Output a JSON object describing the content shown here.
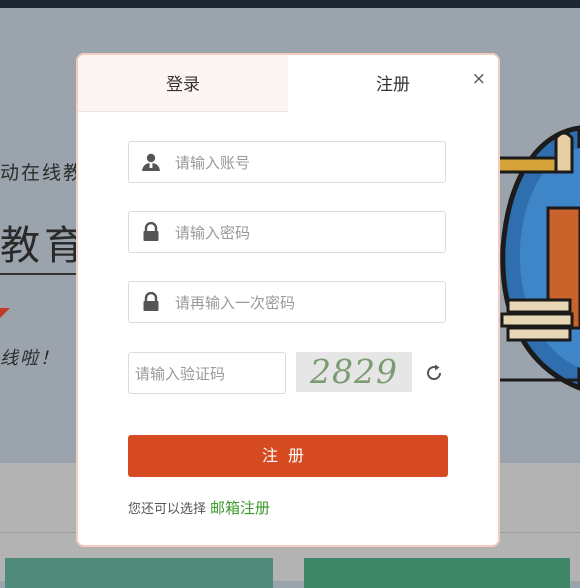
{
  "background": {
    "line1": "动在线教",
    "line2": "教育系",
    "line3": "线啦！"
  },
  "modal": {
    "tabs": [
      {
        "label": "登录",
        "active": false
      },
      {
        "label": "注册",
        "active": true
      }
    ],
    "close_label": "×",
    "fields": {
      "account_placeholder": "请输入账号",
      "password_placeholder": "请输入密码",
      "confirm_placeholder": "请再输入一次密码",
      "captcha_placeholder": "请输入验证码"
    },
    "captcha_code": "2829",
    "submit_label": "注册",
    "alt_text": "您还可以选择",
    "alt_link": "邮箱注册"
  },
  "colors": {
    "accent": "#d54a21",
    "link": "#3c9a2c",
    "modal_border": "#f4cbc1"
  },
  "icons": [
    "user-icon",
    "lock-icon",
    "refresh-icon",
    "close-icon"
  ]
}
